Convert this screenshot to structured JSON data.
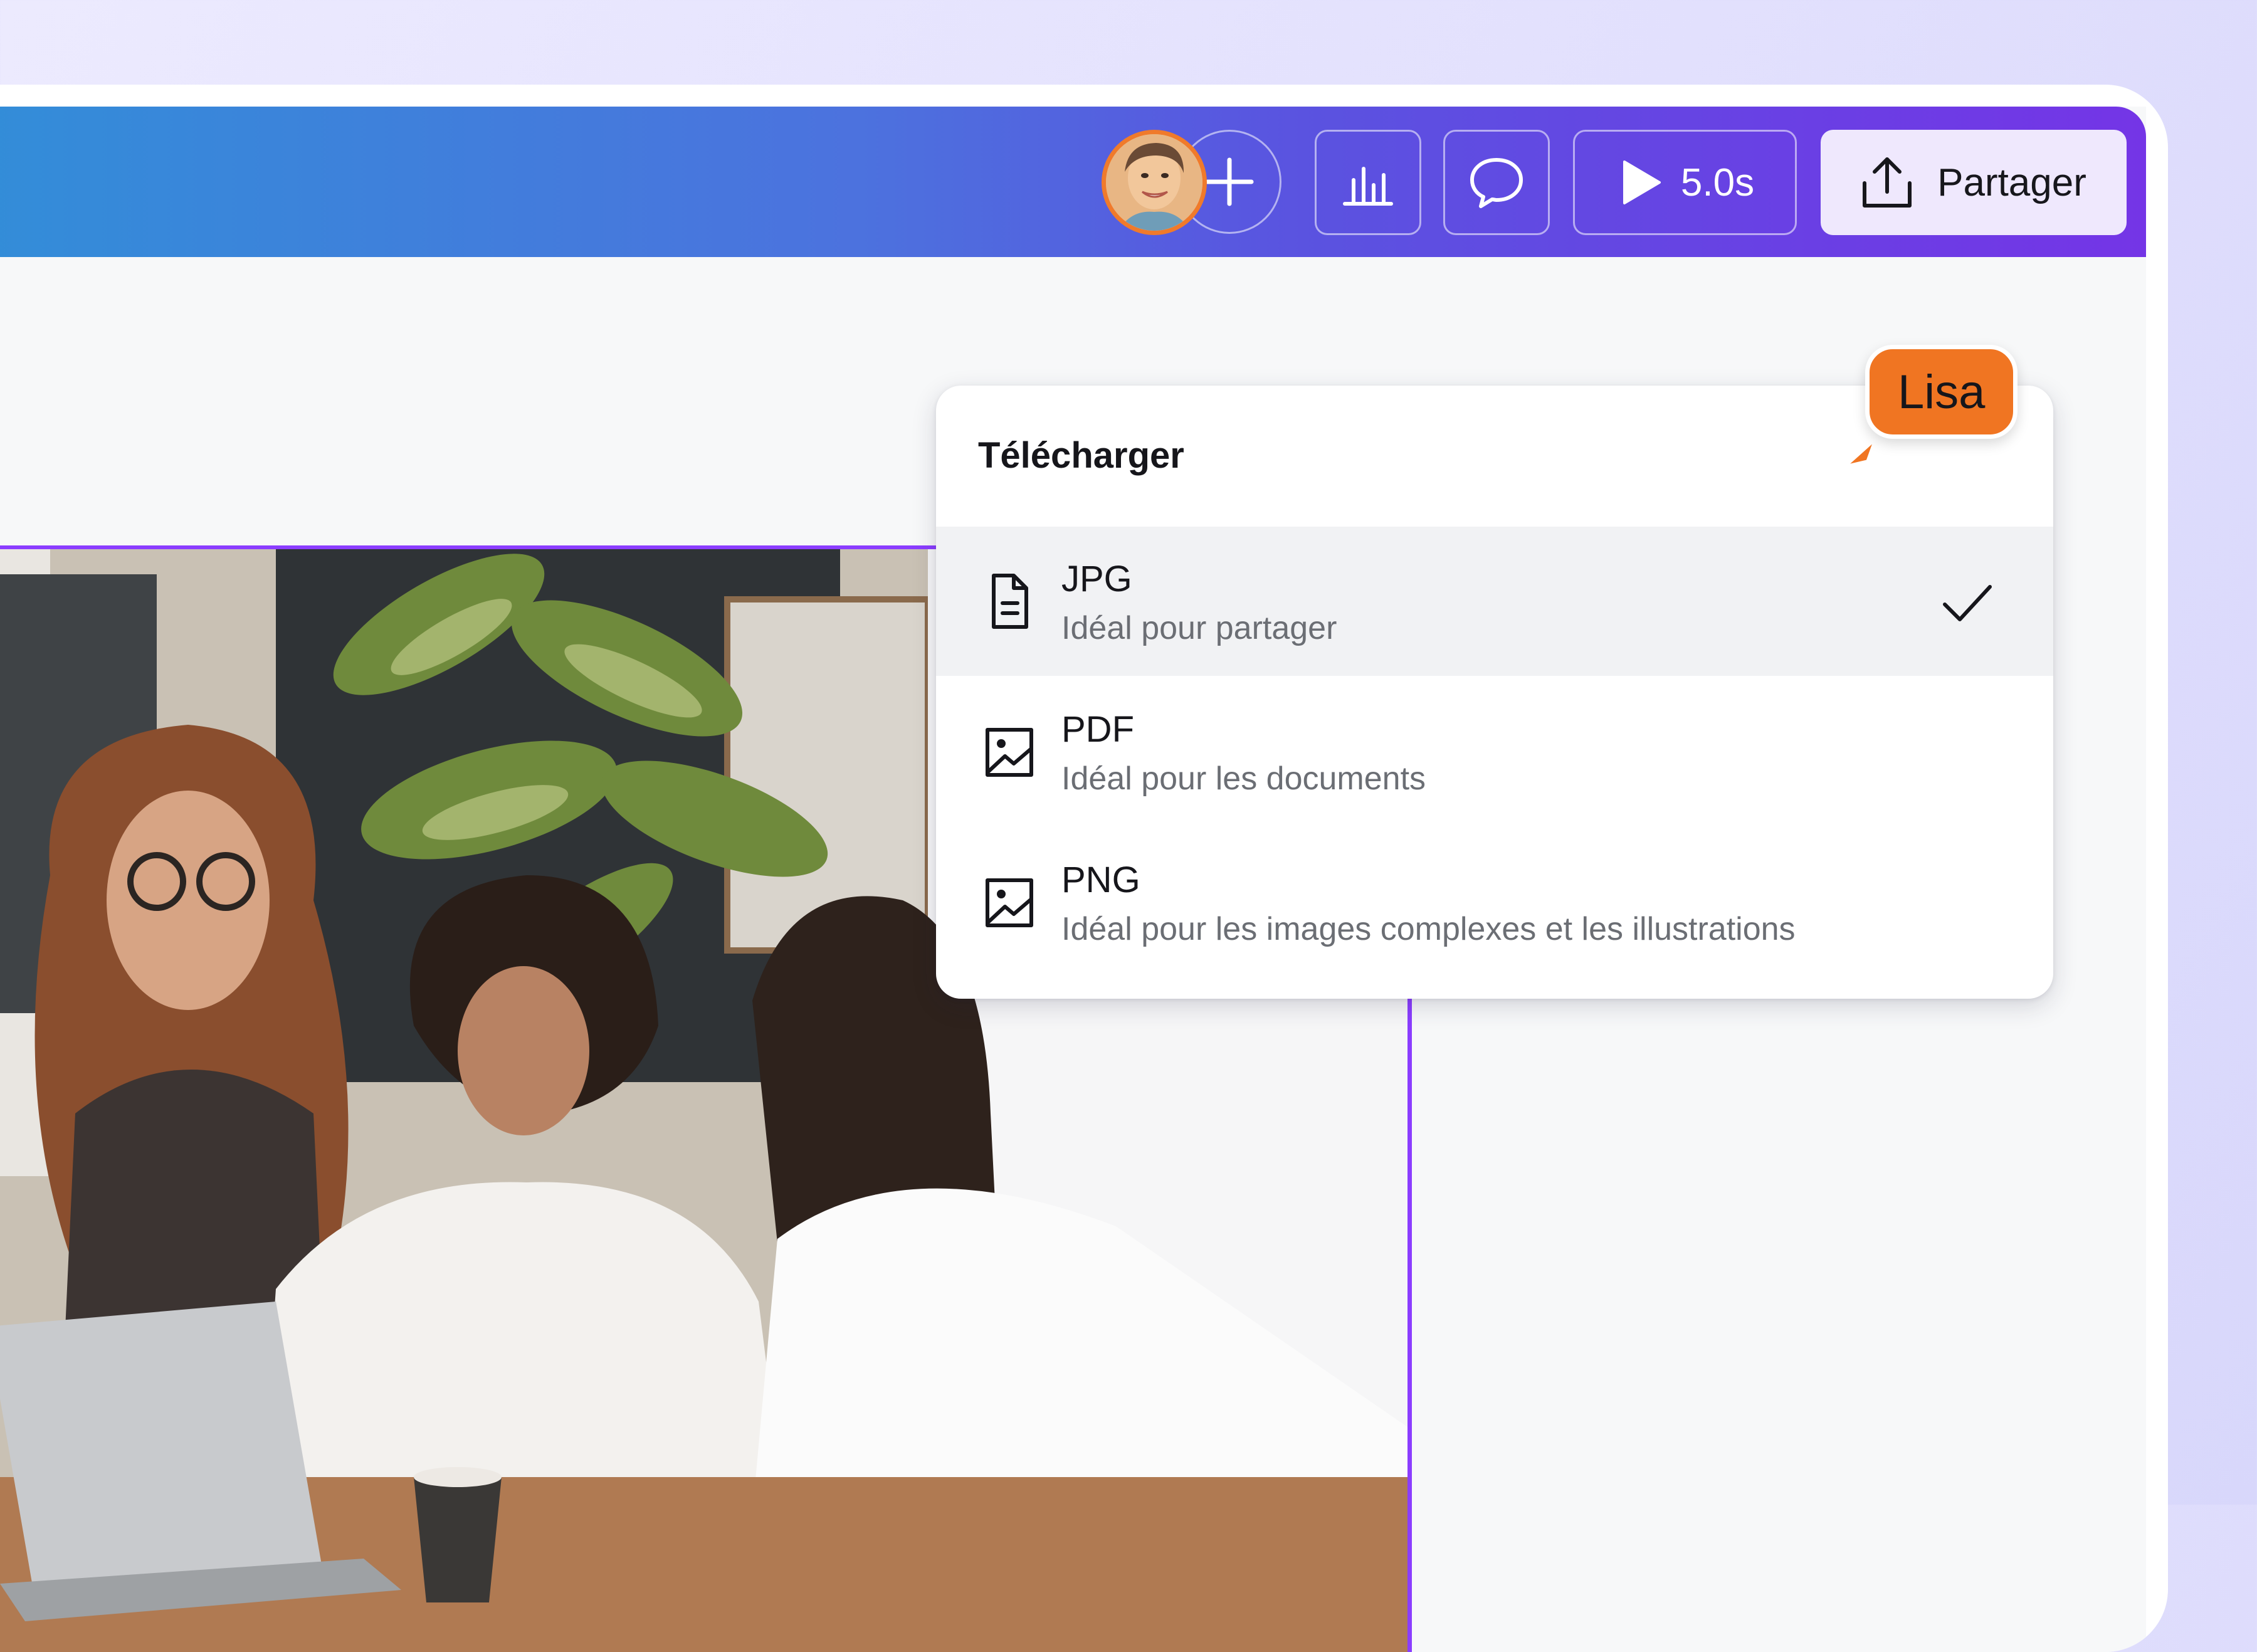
{
  "toolbar": {
    "avatar_alt": "avatar",
    "add_collaborator": "+",
    "play_duration": "5.0s",
    "share_label": "Partager"
  },
  "download_menu": {
    "title": "Télécharger",
    "items": [
      {
        "label": "JPG",
        "description": "Idéal pour partager",
        "icon": "document-icon",
        "selected": true
      },
      {
        "label": "PDF",
        "description": "Idéal pour les documents",
        "icon": "image-icon",
        "selected": false
      },
      {
        "label": "PNG",
        "description": "Idéal pour les images complexes et les illustrations",
        "icon": "image-icon",
        "selected": false
      }
    ]
  },
  "collaborator_cursor": {
    "name": "Lisa",
    "color": "#f07522"
  },
  "colors": {
    "selection": "#8b3dff",
    "avatar_ring": "#f07a2b",
    "share_button_bg": "#efe8fd"
  }
}
